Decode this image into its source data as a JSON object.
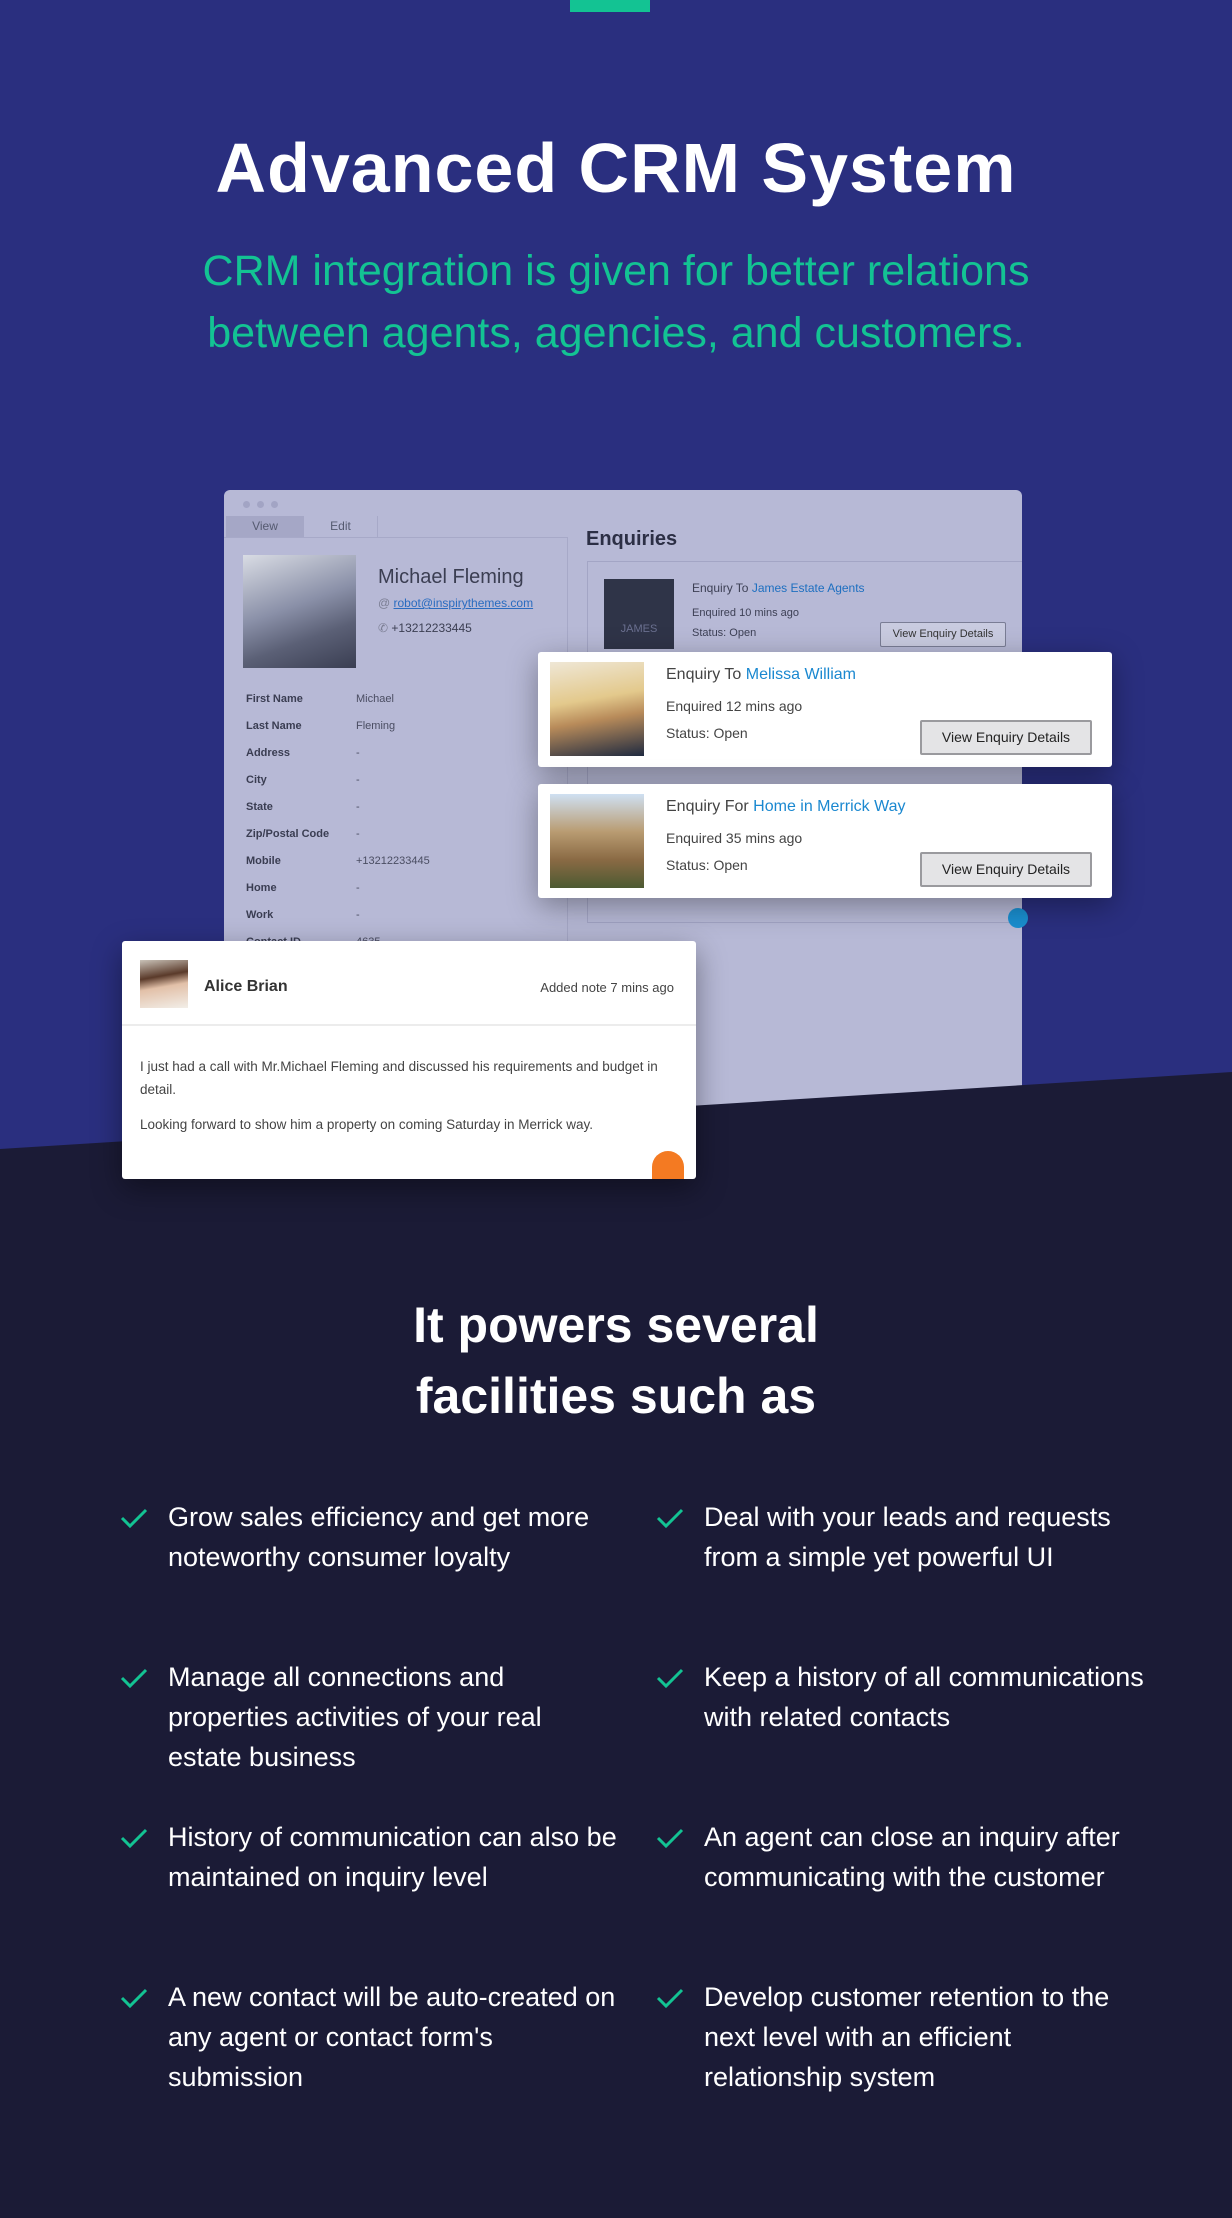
{
  "hero": {
    "title": "Advanced CRM System",
    "subtitle": "CRM integration is given for better relations between agents, agencies, and customers.",
    "colors": {
      "background": "#2a2f7f",
      "accent": "#13c393",
      "dark_background": "#1b1b36"
    }
  },
  "crm_window": {
    "tabs": [
      "View",
      "Edit"
    ],
    "contact": {
      "name": "Michael Fleming",
      "email": "robot@inspirythemes.com",
      "phone": "+13212233445",
      "fields": [
        {
          "label": "First Name",
          "value": "Michael"
        },
        {
          "label": "Last Name",
          "value": "Fleming"
        },
        {
          "label": "Address",
          "value": "-"
        },
        {
          "label": "City",
          "value": "-"
        },
        {
          "label": "State",
          "value": "-"
        },
        {
          "label": "Zip/Postal Code",
          "value": "-"
        },
        {
          "label": "Mobile",
          "value": "+13212233445"
        },
        {
          "label": "Home",
          "value": "-"
        },
        {
          "label": "Work",
          "value": "-"
        },
        {
          "label": "Contact ID",
          "value": "4635"
        }
      ]
    },
    "enquiries_title": "Enquiries",
    "enquiries": [
      {
        "prefix": "Enquiry To",
        "target": "James Estate Agents",
        "time": "Enquired 10 mins ago",
        "status": "Status: Open",
        "button": "View Enquiry Details",
        "logo_text": "JAMES"
      },
      {
        "prefix": "Enquiry To",
        "target": "Melissa William",
        "time": "Enquired 12 mins ago",
        "status": "Status: Open",
        "button": "View Enquiry Details"
      },
      {
        "prefix": "Enquiry For",
        "target": "Home in Merrick Way",
        "time": "Enquired 35 mins ago",
        "status": "Status: Open",
        "button": "View Enquiry Details"
      }
    ]
  },
  "note": {
    "author": "Alice Brian",
    "meta": "Added note 7 mins ago",
    "paragraphs": [
      "I just had a call with Mr.Michael Fleming and discussed his requirements and budget in detail.",
      "Looking forward to show him a property on coming Saturday in Merrick way."
    ]
  },
  "features": {
    "heading_line1": "It powers several",
    "heading_line2": "facilities such as",
    "left": [
      "Grow sales efficiency and get more noteworthy consumer loyalty",
      "Manage all connections and properties activities of your real estate business",
      "History of communication can also be maintained on inquiry level",
      "A new contact will be auto-created on any agent or contact form's submission"
    ],
    "right": [
      "Deal with your leads and requests from a simple yet powerful UI",
      "Keep a history of all communications with related contacts",
      "An agent can close an inquiry after communicating with the customer",
      "Develop customer retention to the next level with an efficient relationship system"
    ],
    "icon": "check-icon"
  }
}
